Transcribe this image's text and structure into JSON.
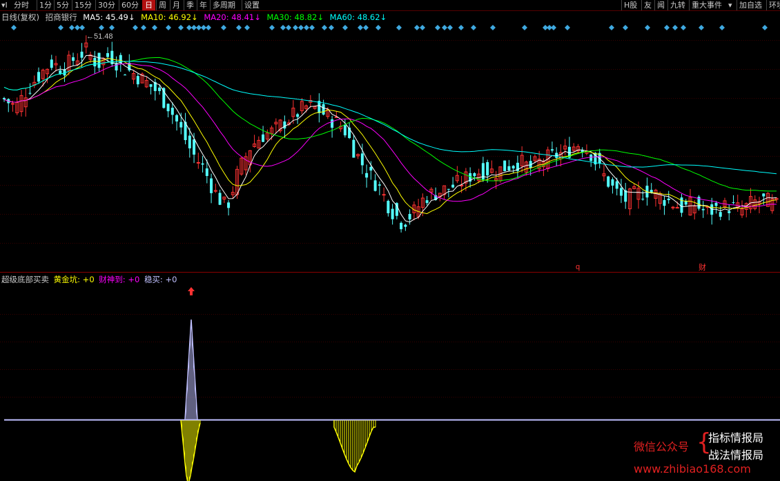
{
  "toolbar": {
    "items": [
      "分时",
      "1分",
      "5分",
      "15分",
      "30分",
      "60分",
      "日",
      "周",
      "月",
      "季",
      "年",
      "多周期",
      "设置"
    ],
    "active": "日",
    "right_items": [
      "H股",
      "友",
      "闻",
      "九转",
      "重大事件",
      "加自选",
      "环境"
    ]
  },
  "main_header": {
    "period_label": "日线(复权)",
    "stock_name": "招商银行",
    "ma5": "MA5: 45.49↓",
    "ma10": "MA10: 46.92↓",
    "ma20": "MA20: 48.41↓",
    "ma30": "MA30: 48.82↓",
    "ma60": "MA60: 48.62↓",
    "colors": {
      "ma5": "#ffffff",
      "ma10": "#ffff00",
      "ma20": "#ff00ff",
      "ma30": "#00ff00",
      "ma60": "#00ffff"
    }
  },
  "high_marker": "51.48",
  "event_markers": [
    "q",
    "财"
  ],
  "sub_header": {
    "indicator_name": "超级底部买卖",
    "gold_pit": "黄金坑: +0",
    "wealth": "财神到: +0",
    "steady": "稳买: +0",
    "colors": {
      "gold_pit": "#ffff00",
      "wealth": "#ff00ff",
      "steady": "#c0c0ff"
    }
  },
  "colors": {
    "up": "#ff3232",
    "down": "#54ffff",
    "diamond": "#3fa9e0",
    "grid": "#550000",
    "volume_line": "#c0c0ff",
    "pit": "#ffff00"
  },
  "watermark": {
    "wechat": "微信公众号",
    "line1": "指标情报局",
    "line2": "战法情报局",
    "site": "www.zhibiao168.com"
  },
  "chart_data": {
    "type": "candlestick",
    "series": [
      {
        "name": "MA5",
        "values_hint": "declining"
      },
      {
        "name": "MA10"
      },
      {
        "name": "MA20"
      },
      {
        "name": "MA30"
      },
      {
        "name": "MA60"
      }
    ],
    "close_path": [
      48.6,
      48.2,
      49.1,
      49.8,
      50.4,
      50.1,
      50.6,
      51.0,
      50.3,
      50.8,
      50.2,
      49.9,
      49.5,
      49.0,
      48.3,
      47.2,
      46.0,
      45.2,
      44.0,
      43.2,
      45.0,
      46.2,
      46.8,
      47.0,
      47.5,
      47.9,
      48.3,
      48.0,
      47.6,
      47.2,
      46.0,
      45.0,
      44.3,
      43.2,
      42.5,
      43.0,
      43.8,
      44.0,
      44.2,
      44.5,
      44.9,
      45.1,
      45.0,
      45.3,
      45.5,
      45.2,
      45.6,
      45.8,
      46.0,
      46.4,
      46.1,
      45.0,
      44.2,
      43.6,
      43.9,
      44.1,
      43.8,
      43.5,
      43.2,
      43.4,
      43.0,
      43.2,
      43.3,
      43.1,
      43.5,
      43.6,
      43.3
    ]
  }
}
